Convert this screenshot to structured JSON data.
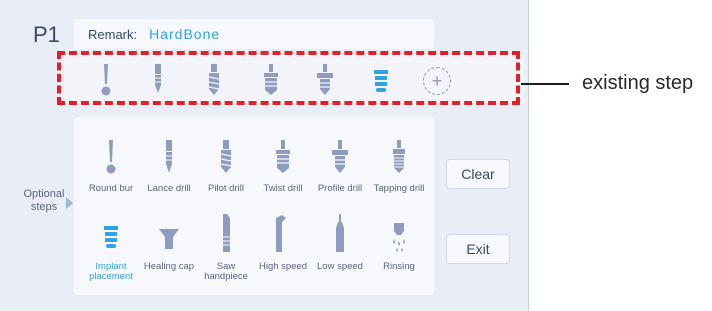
{
  "header": {
    "program_label": "P1",
    "remark_label": "Remark:",
    "remark_value": "HardBone"
  },
  "existing_steps": [
    {
      "icon": "round-bur-icon"
    },
    {
      "icon": "lance-drill-icon"
    },
    {
      "icon": "pilot-drill-icon"
    },
    {
      "icon": "twist-drill-icon"
    },
    {
      "icon": "profile-drill-icon"
    },
    {
      "icon": "implant-placement-icon"
    }
  ],
  "add_button_label": "+",
  "callout": {
    "text": "existing step"
  },
  "optional_steps": {
    "label": "Optional steps",
    "items": [
      {
        "label": "Round bur",
        "icon": "round-bur-icon"
      },
      {
        "label": "Lance drill",
        "icon": "lance-drill-icon"
      },
      {
        "label": "Pilot drill",
        "icon": "pilot-drill-icon"
      },
      {
        "label": "Twist drill",
        "icon": "twist-drill-icon"
      },
      {
        "label": "Profile drill",
        "icon": "profile-drill-icon"
      },
      {
        "label": "Tapping drill",
        "icon": "tapping-drill-icon"
      },
      {
        "label": "Implant placement",
        "icon": "implant-placement-icon",
        "active": true
      },
      {
        "label": "Healing cap",
        "icon": "healing-cap-icon"
      },
      {
        "label": "Saw handpiece",
        "icon": "saw-handpiece-icon"
      },
      {
        "label": "High speed",
        "icon": "high-speed-icon"
      },
      {
        "label": "Low speed",
        "icon": "low-speed-icon"
      },
      {
        "label": "Rinsing",
        "icon": "rinsing-icon"
      }
    ]
  },
  "buttons": {
    "clear": "Clear",
    "exit": "Exit"
  },
  "colors": {
    "accent": "#2fa3e6",
    "tool": "#8e9cc0",
    "highlight_border": "#e3202a"
  }
}
